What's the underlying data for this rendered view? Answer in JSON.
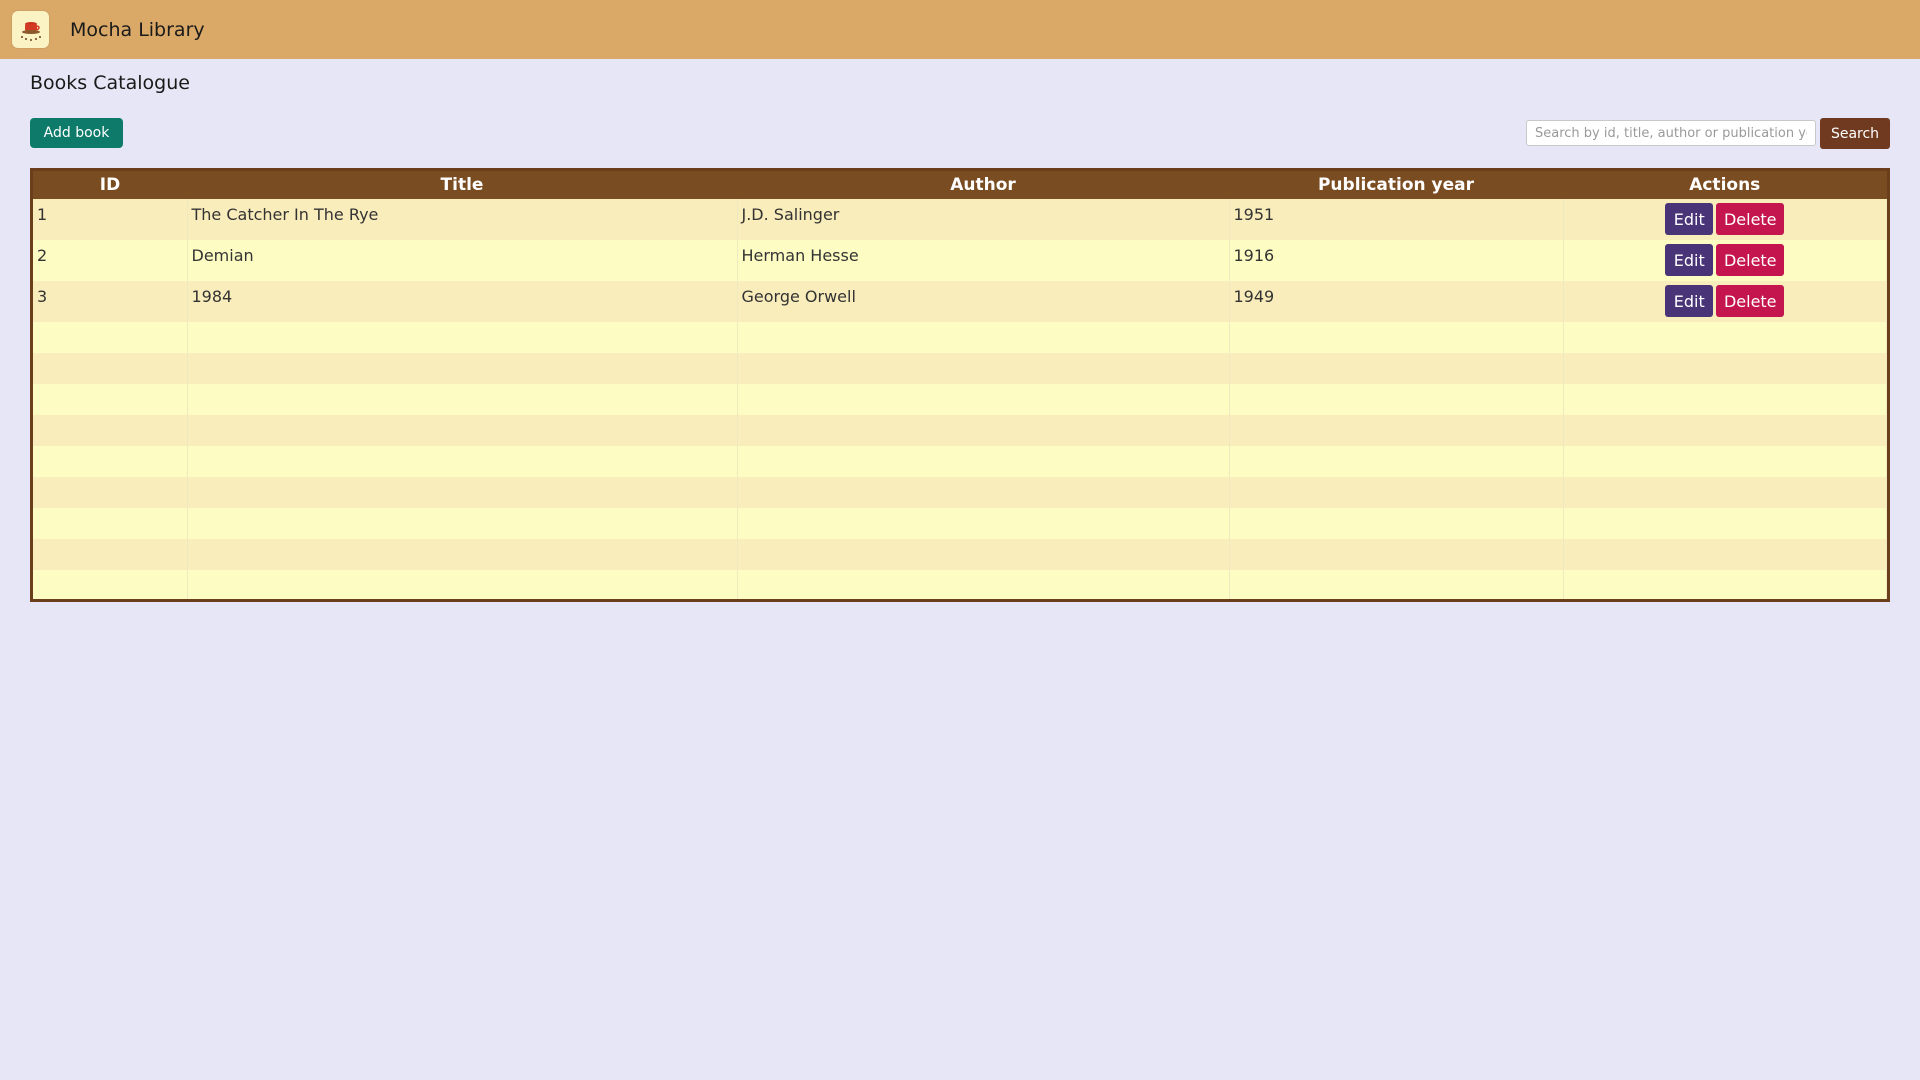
{
  "app": {
    "title": "Mocha Library",
    "logo_icon": "coffee-cup-icon"
  },
  "page": {
    "title": "Books Catalogue"
  },
  "toolbar": {
    "add_label": "Add book",
    "search_placeholder": "Search by id, title, author or publication year...",
    "search_label": "Search"
  },
  "table": {
    "headers": [
      "ID",
      "Title",
      "Author",
      "Publication year",
      "Actions"
    ],
    "rows": [
      {
        "id": "1",
        "title": "The Catcher In The Rye",
        "author": "J.D. Salinger",
        "year": "1951"
      },
      {
        "id": "2",
        "title": "Demian",
        "author": "Herman Hesse",
        "year": "1916"
      },
      {
        "id": "3",
        "title": "1984",
        "author": "George Orwell",
        "year": "1949"
      }
    ],
    "edit_label": "Edit",
    "delete_label": "Delete"
  },
  "colors": {
    "topbar": "#daa968",
    "background": "#e6e6f7",
    "add_button": "#0e7a6a",
    "search_button": "#6f3a1f",
    "table_header": "#7a4c22",
    "edit_button": "#4a3478",
    "delete_button": "#c5154e"
  }
}
